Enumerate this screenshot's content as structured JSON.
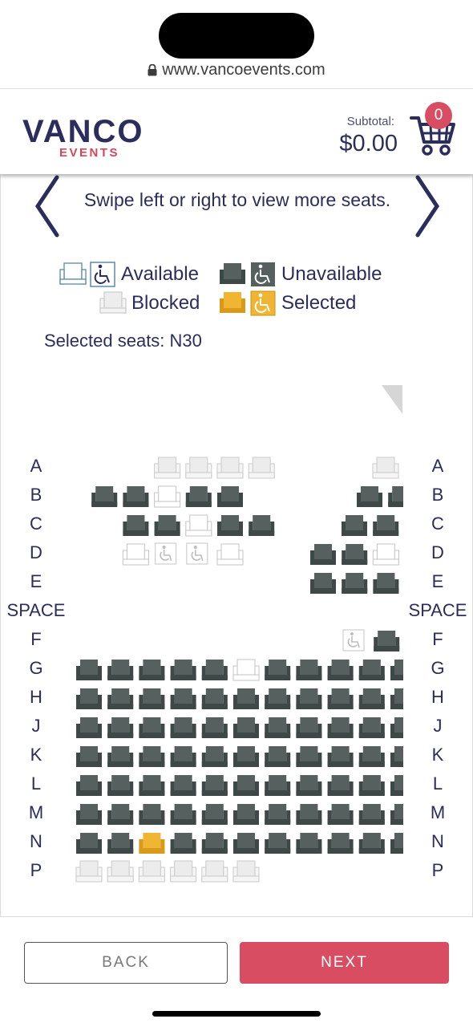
{
  "browser": {
    "url": "www.vancoevents.com"
  },
  "header": {
    "logo_main": "VANCO",
    "logo_sub": "EVENTS",
    "subtotal_label": "Subtotal:",
    "subtotal_value": "$0.00",
    "cart_count": "0"
  },
  "seatmap": {
    "swipe_hint": "Swipe left or right to view more seats.",
    "legend": {
      "available": "Available",
      "unavailable": "Unavailable",
      "blocked": "Blocked",
      "selected": "Selected"
    },
    "selected_seats_text": "Selected seats: N30",
    "row_labels": [
      "A",
      "B",
      "C",
      "D",
      "E",
      "SPACE",
      "F",
      "G",
      "H",
      "J",
      "K",
      "L",
      "M",
      "N",
      "P"
    ],
    "colors": {
      "unavailable": "#55605f",
      "selected": "#f0b533",
      "available_outline": "#5e8aa8",
      "blocked": "#cfcfcf",
      "brand_navy": "#2b2d5c",
      "brand_red": "#d94d63"
    },
    "rows": [
      {
        "row": "A",
        "left": [
          null,
          null,
          null,
          "blocked",
          "blocked",
          "blocked",
          "blocked"
        ],
        "right": [
          "blocked",
          "blocked"
        ]
      },
      {
        "row": "B",
        "left": [
          null,
          "unavailable",
          "unavailable",
          "available",
          "unavailable",
          "unavailable"
        ],
        "right": [
          "unavailable",
          "unavailable"
        ]
      },
      {
        "row": "C",
        "left": [
          null,
          null,
          "unavailable",
          "unavailable",
          "available",
          "unavailable",
          "unavailable"
        ],
        "right": [
          "unavailable",
          "unavailable",
          "available"
        ]
      },
      {
        "row": "D",
        "left": [
          null,
          null,
          "available",
          "wheelchair-available",
          "wheelchair-available",
          "available"
        ],
        "right": [
          "unavailable",
          "unavailable",
          "available",
          "available"
        ]
      },
      {
        "row": "E",
        "left": [],
        "right": [
          "unavailable",
          "unavailable",
          "unavailable",
          "unavailable"
        ]
      },
      {
        "row": "F",
        "left": [],
        "right": [
          "wheelchair-available",
          "unavailable"
        ]
      },
      {
        "row": "G",
        "left": [
          "unavailable",
          "unavailable",
          "unavailable",
          "unavailable",
          "unavailable",
          "available",
          "unavailable",
          "unavailable",
          "unavailable",
          "unavailable",
          "unavailable"
        ]
      },
      {
        "row": "H",
        "left": [
          "unavailable",
          "unavailable",
          "unavailable",
          "unavailable",
          "unavailable",
          "unavailable",
          "unavailable",
          "unavailable",
          "unavailable",
          "unavailable",
          "unavailable"
        ]
      },
      {
        "row": "J",
        "left": [
          "unavailable",
          "unavailable",
          "unavailable",
          "unavailable",
          "unavailable",
          "unavailable",
          "unavailable",
          "unavailable",
          "unavailable",
          "unavailable",
          "unavailable"
        ]
      },
      {
        "row": "K",
        "left": [
          "unavailable",
          "unavailable",
          "unavailable",
          "unavailable",
          "unavailable",
          "unavailable",
          "unavailable",
          "unavailable",
          "unavailable",
          "unavailable",
          "unavailable"
        ]
      },
      {
        "row": "L",
        "left": [
          "unavailable",
          "unavailable",
          "unavailable",
          "unavailable",
          "unavailable",
          "unavailable",
          "unavailable",
          "unavailable",
          "unavailable",
          "unavailable",
          "unavailable"
        ]
      },
      {
        "row": "M",
        "left": [
          "unavailable",
          "unavailable",
          "unavailable",
          "unavailable",
          "unavailable",
          "unavailable",
          "unavailable",
          "unavailable",
          "unavailable",
          "unavailable",
          "unavailable"
        ]
      },
      {
        "row": "N",
        "left": [
          "unavailable",
          "unavailable",
          "selected",
          "unavailable",
          "unavailable",
          "unavailable",
          "unavailable",
          "unavailable",
          "unavailable",
          "unavailable",
          "unavailable"
        ]
      },
      {
        "row": "P",
        "left": [
          "blocked",
          "blocked",
          "blocked",
          "blocked",
          "blocked",
          "blocked"
        ]
      }
    ]
  },
  "footer": {
    "back_label": "BACK",
    "next_label": "NEXT"
  }
}
